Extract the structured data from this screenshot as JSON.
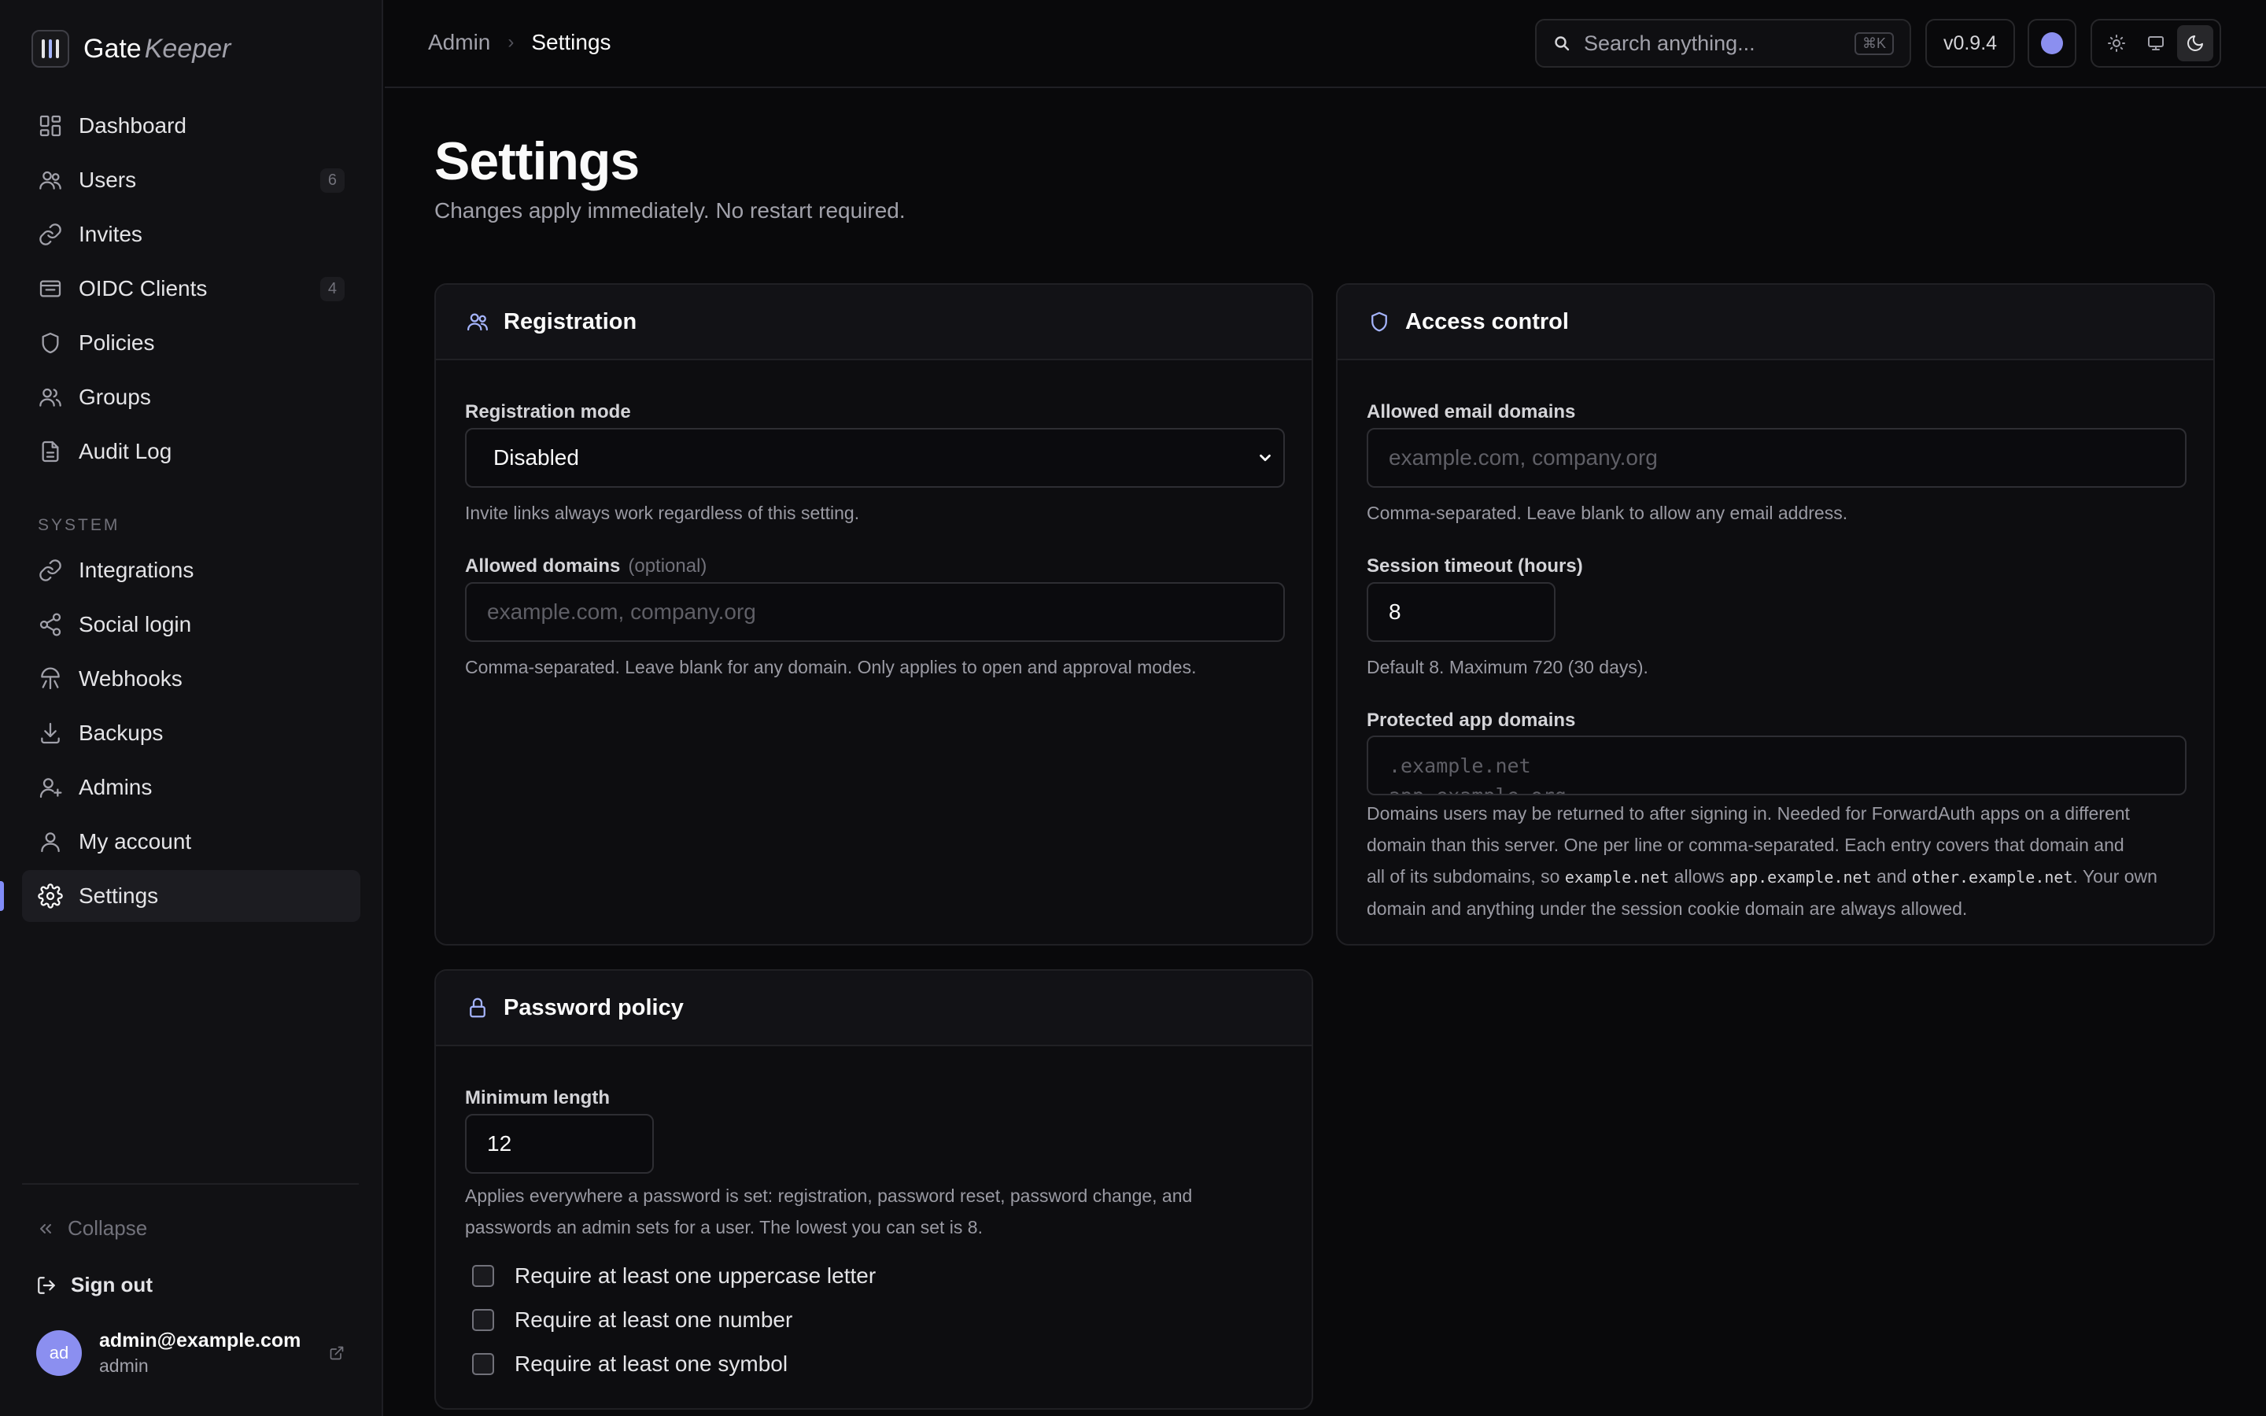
{
  "brand": {
    "name_a": "Gate",
    "name_b": "Keeper"
  },
  "sidebar": {
    "items": [
      {
        "label": "Dashboard",
        "icon": "dashboard-icon"
      },
      {
        "label": "Users",
        "icon": "users-icon",
        "badge": "6"
      },
      {
        "label": "Invites",
        "icon": "link-icon"
      },
      {
        "label": "OIDC Clients",
        "icon": "inbox-icon",
        "badge": "4"
      },
      {
        "label": "Policies",
        "icon": "shield-icon"
      },
      {
        "label": "Groups",
        "icon": "group-icon"
      },
      {
        "label": "Audit Log",
        "icon": "document-icon"
      }
    ],
    "system_label": "SYSTEM",
    "system_items": [
      {
        "label": "Integrations",
        "icon": "link-icon"
      },
      {
        "label": "Social login",
        "icon": "share-icon"
      },
      {
        "label": "Webhooks",
        "icon": "webhook-icon"
      },
      {
        "label": "Backups",
        "icon": "download-icon"
      },
      {
        "label": "Admins",
        "icon": "user-plus-icon"
      },
      {
        "label": "My account",
        "icon": "user-icon"
      },
      {
        "label": "Settings",
        "icon": "gear-icon",
        "active": true
      }
    ],
    "collapse": "Collapse",
    "sign_out": "Sign out",
    "user": {
      "initials": "ad",
      "email": "admin@example.com",
      "role": "admin"
    }
  },
  "topbar": {
    "breadcrumb": [
      "Admin",
      "Settings"
    ],
    "search_placeholder": "Search anything...",
    "shortcut": "⌘K",
    "version": "v0.9.4"
  },
  "page": {
    "title": "Settings",
    "subtitle": "Changes apply immediately. No restart required."
  },
  "registration": {
    "title": "Registration",
    "mode_label": "Registration mode",
    "mode_value": "Disabled",
    "mode_help": "Invite links always work regardless of this setting.",
    "domains_label": "Allowed domains",
    "domains_optional": "(optional)",
    "domains_placeholder": "example.com, company.org",
    "domains_help": "Comma-separated. Leave blank for any domain. Only applies to open and approval modes."
  },
  "access": {
    "title": "Access control",
    "email_label": "Allowed email domains",
    "email_placeholder": "example.com, company.org",
    "email_help": "Comma-separated. Leave blank to allow any email address.",
    "timeout_label": "Session timeout (hours)",
    "timeout_value": "8",
    "timeout_help": "Default 8. Maximum 720 (30 days).",
    "protected_label": "Protected app domains",
    "protected_placeholder_1": ".example.net",
    "protected_placeholder_2": "app.example.org",
    "protected_help_1": "Domains users may be returned to after signing in. Needed for ForwardAuth apps on a different",
    "protected_help_2": "domain than this server. One per line or comma-separated. Each entry covers that domain and",
    "protected_help_3a": "all of its subdomains, so ",
    "protected_help_code1": "example.net",
    "protected_help_3b": " allows ",
    "protected_help_code2": "app.example.net",
    "protected_help_3c": " and ",
    "protected_help_code3": "other.example.net",
    "protected_help_3d": ". Your own",
    "protected_help_4": "domain and anything under the session cookie domain are always allowed."
  },
  "password": {
    "title": "Password policy",
    "min_label": "Minimum length",
    "min_value": "12",
    "min_help_1": "Applies everywhere a password is set: registration, password reset, password change, and",
    "min_help_2": "passwords an admin sets for a user. The lowest you can set is 8.",
    "checks": [
      "Require at least one uppercase letter",
      "Require at least one number",
      "Require at least one symbol"
    ]
  },
  "colors": {
    "accent": "#818cf8",
    "background": "#09090b",
    "sidebar": "#111114"
  }
}
